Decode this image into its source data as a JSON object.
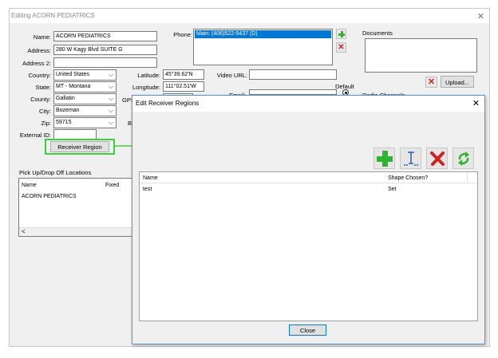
{
  "window": {
    "title": "Editing ACORN PEDIATRICS"
  },
  "form": {
    "name_label": "Name:",
    "name_value": "ACORN PEDIATRICS",
    "address_label": "Address:",
    "address_value": "280 W Kagy Blvd SUITE G",
    "address2_label": "Address 2:",
    "address2_value": "",
    "country_label": "Country:",
    "country_value": "United States",
    "state_label": "State:",
    "state_value": "MT - Montana",
    "county_label": "County:",
    "county_value": "Gallatin",
    "city_label": "City:",
    "city_value": "Bozeman",
    "zip_label": "Zip:",
    "zip_value": "59715",
    "external_id_label": "External ID:",
    "external_id_value": "",
    "receiver_region_button": "Receiver Region",
    "phone_label": "Phone:",
    "phone_items": [
      "Main: (406)522-5437 (D)"
    ],
    "latitude_label": "Latitude:",
    "latitude_value": "45°39.62'N",
    "longitude_label": "Longitude:",
    "longitude_value": "111°02.51'W",
    "gps_label_partial": "GPS",
    "bi_label_partial": "Bil",
    "video_url_label": "Video URL:",
    "video_url_value": "",
    "email_label_partial": "Email:",
    "default_label": "Default",
    "documents_label": "Documents",
    "upload_button": "Upload...",
    "radio_channels_partial": "Radio Channels"
  },
  "pickup": {
    "title": "Pick Up/Drop Off Locations",
    "columns": [
      "Name",
      "Fixed"
    ],
    "rows": [
      {
        "name": "ACORN PEDIATRICS"
      }
    ],
    "scroll_left": "<"
  },
  "dialog": {
    "title": "Edit Receiver Regions",
    "columns": [
      "Name",
      "Shape Chosen?"
    ],
    "rows": [
      {
        "name": "test",
        "shape": "Set"
      }
    ],
    "close_button": "Close",
    "toolbar_icons": [
      "add-icon",
      "edit-shape-icon",
      "delete-icon",
      "refresh-icon"
    ]
  },
  "colors": {
    "accent_green": "#2db52d",
    "delete_red": "#d42020",
    "highlight_border": "#3ccf3c",
    "selection_blue": "#0078d7"
  }
}
